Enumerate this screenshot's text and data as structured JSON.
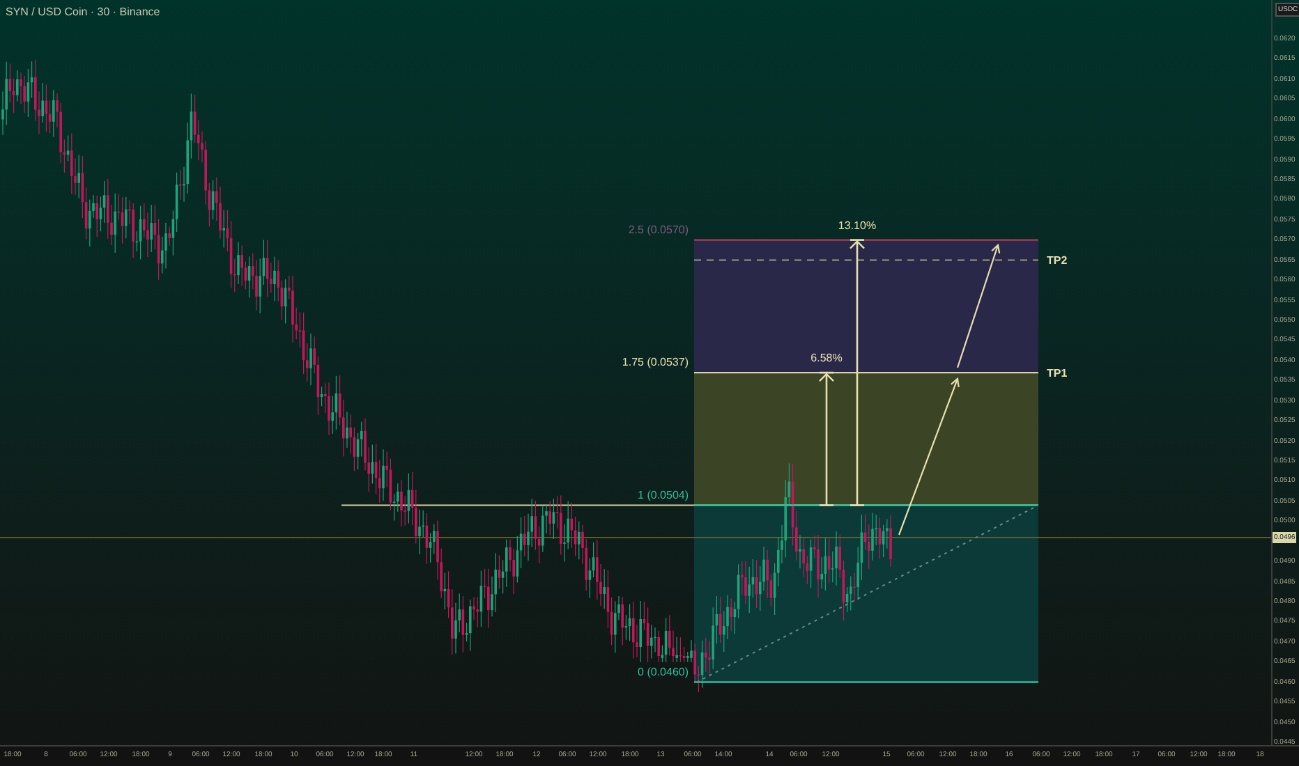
{
  "header": {
    "title": "SYN / USD Coin · 30 · Binance"
  },
  "price_axis": {
    "currency": "USDC",
    "current_price": "0.0496",
    "ticks": [
      "0.0620",
      "0.0615",
      "0.0610",
      "0.0605",
      "0.0600",
      "0.0595",
      "0.0590",
      "0.0585",
      "0.0580",
      "0.0575",
      "0.0570",
      "0.0565",
      "0.0560",
      "0.0555",
      "0.0550",
      "0.0545",
      "0.0540",
      "0.0535",
      "0.0530",
      "0.0525",
      "0.0520",
      "0.0515",
      "0.0510",
      "0.0505",
      "0.0500",
      "0.0490",
      "0.0485",
      "0.0480",
      "0.0475",
      "0.0470",
      "0.0465",
      "0.0460",
      "0.0455",
      "0.0450",
      "0.0445"
    ]
  },
  "time_axis": {
    "labels": [
      "18:00",
      "8",
      "06:00",
      "12:00",
      "18:00",
      "9",
      "06:00",
      "12:00",
      "18:00",
      "10",
      "06:00",
      "12:00",
      "18:00",
      "11",
      "12:00",
      "18:00",
      "12",
      "06:00",
      "12:00",
      "18:00",
      "13",
      "06:00",
      "14:00",
      "14",
      "06:00",
      "12:00",
      "15",
      "06:00",
      "12:00",
      "18:00",
      "16",
      "06:00",
      "12:00",
      "18:00",
      "17",
      "06:00",
      "12:00",
      "18:00",
      "18"
    ]
  },
  "fib_levels": [
    {
      "label": "2.5 (0.0570)",
      "color": "#7a5a7a"
    },
    {
      "label": "1.75 (0.0537)",
      "color": "#e6e0b0"
    },
    {
      "label": "1 (0.0504)",
      "color": "#2fbf9a"
    },
    {
      "label": "0 (0.0460)",
      "color": "#2fbf9a"
    }
  ],
  "targets": [
    "TP2",
    "TP1"
  ],
  "measures": [
    "6.58%",
    "13.10%"
  ]
}
